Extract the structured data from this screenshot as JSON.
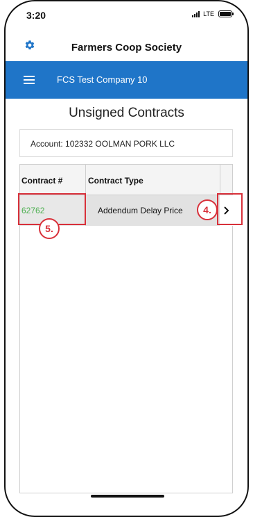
{
  "status_bar": {
    "time": "3:20",
    "network": "LTE"
  },
  "header": {
    "title": "Farmers Coop Society",
    "settings_icon": "gear-icon",
    "accent_color": "#1f75c8"
  },
  "company_bar": {
    "menu_icon": "hamburger-icon",
    "company_name": "FCS Test Company 10"
  },
  "page": {
    "title": "Unsigned Contracts"
  },
  "account": {
    "label": "Account: 102332 OOLMAN PORK LLC"
  },
  "table": {
    "columns": [
      "Contract #",
      "Contract Type",
      ""
    ],
    "rows": [
      {
        "contract_number": "62762",
        "contract_type": "Addendum Delay Price",
        "action_icon": "chevron-right-icon"
      }
    ]
  },
  "annotations": [
    {
      "label": "4.",
      "color": "#d8303a"
    },
    {
      "label": "5.",
      "color": "#d8303a"
    }
  ]
}
